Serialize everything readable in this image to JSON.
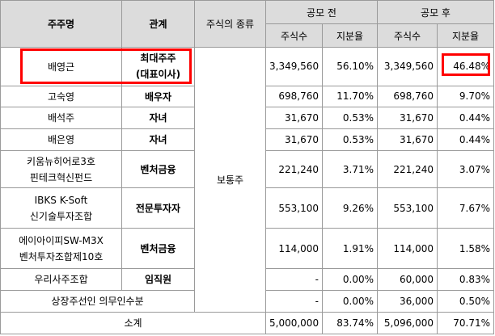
{
  "header": {
    "shareholder": "주주명",
    "relation": "관계",
    "stock_type": "주식의 종류",
    "before_ipo": "공모 전",
    "after_ipo": "공모 후",
    "shares": "주식수",
    "ratio": "지분율"
  },
  "stock_type_value": "보통주",
  "rows": [
    {
      "name": "배영근",
      "relation": "최대주주\n(대표이사)",
      "before_shares": "3,349,560",
      "before_ratio": "56.10%",
      "after_shares": "3,349,560",
      "after_ratio": "46.48%"
    },
    {
      "name": "고숙영",
      "relation": "배우자",
      "before_shares": "698,760",
      "before_ratio": "11.70%",
      "after_shares": "698,760",
      "after_ratio": "9.70%"
    },
    {
      "name": "배석주",
      "relation": "자녀",
      "before_shares": "31,670",
      "before_ratio": "0.53%",
      "after_shares": "31,670",
      "after_ratio": "0.44%"
    },
    {
      "name": "배은영",
      "relation": "자녀",
      "before_shares": "31,670",
      "before_ratio": "0.53%",
      "after_shares": "31,670",
      "after_ratio": "0.44%"
    },
    {
      "name": "키움뉴히어로3호\n핀테크혁신펀드",
      "relation": "벤처금융",
      "before_shares": "221,240",
      "before_ratio": "3.71%",
      "after_shares": "221,240",
      "after_ratio": "3.07%"
    },
    {
      "name": "IBKS K-Soft\n신기술투자조합",
      "relation": "전문투자자",
      "before_shares": "553,100",
      "before_ratio": "9.26%",
      "after_shares": "553,100",
      "after_ratio": "7.67%"
    },
    {
      "name": "에이아이피SW-M3X\n벤처투자조합제10호",
      "relation": "벤처금융",
      "before_shares": "114,000",
      "before_ratio": "1.91%",
      "after_shares": "114,000",
      "after_ratio": "1.58%"
    },
    {
      "name": "우리사주조합",
      "relation": "임직원",
      "before_shares": "-",
      "before_ratio": "0.00%",
      "after_shares": "60,000",
      "after_ratio": "0.83%"
    }
  ],
  "lockup_row": {
    "name": "상장주선인 의무인수분",
    "before_shares": "-",
    "before_ratio": "0.00%",
    "after_shares": "36,000",
    "after_ratio": "0.50%"
  },
  "total_row": {
    "label": "소계",
    "before_shares": "5,000,000",
    "before_ratio": "83.74%",
    "after_shares": "5,096,000",
    "after_ratio": "70.71%"
  }
}
